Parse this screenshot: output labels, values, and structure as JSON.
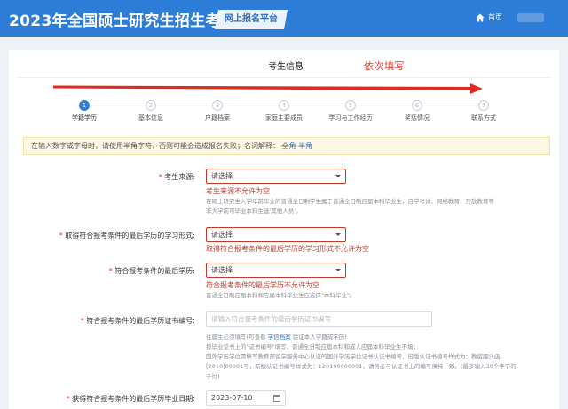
{
  "header": {
    "title": "2023年全国硕士研究生招生考试",
    "platform": "网上报名平台",
    "home_label": "首页"
  },
  "section": {
    "title": "考生信息",
    "note": "依次填写"
  },
  "steps": [
    {
      "num": "1",
      "label": "学籍学历",
      "active": true
    },
    {
      "num": "2",
      "label": "基本信息"
    },
    {
      "num": "3",
      "label": "户籍档案"
    },
    {
      "num": "4",
      "label": "家庭主要成员"
    },
    {
      "num": "5",
      "label": "学习与工作经历"
    },
    {
      "num": "6",
      "label": "奖惩情况"
    },
    {
      "num": "7",
      "label": "联系方式"
    }
  ],
  "notice": {
    "text": "在输入数字或字母时，请使用半角字符，否则可能会造成报名失败；名词解释：",
    "link1": "全角",
    "link2": "半角"
  },
  "form": {
    "source": {
      "label": "考生来源:",
      "value": "请选择",
      "error": "考生来源不允许为空",
      "help1": "在硕士研究生入学年前毕业的普通全日制学生属于普通全日制应届本科毕业生，自学考试、网络教育、开放教育等",
      "help2": "非大学前可毕业本科生选'其他人员'。"
    },
    "study_form": {
      "label": "取得符合报考条件的最后学历的学习形式:",
      "value": "请选择",
      "error": "取得符合报考条件的最后学历的学习形式不允许为空"
    },
    "last_degree": {
      "label": "符合报考条件的最后学历:",
      "value": "请选择",
      "error": "符合报考条件的最后学历不允许为空",
      "help": "普通全日制应届本科和应届本科毕业生应选择\"本科毕业\"。"
    },
    "cert_no": {
      "label": "符合报考条件的最后学历证书编号:",
      "placeholder": "请输入符合报考条件的最后学历证书编号",
      "help1": "往届生必须填写(可查看",
      "help_link": "学信档案",
      "help1b": "验证本人学籍或学历)",
      "help2": "按毕业证书上的\"证书编号\"填写，普通全日制应届本科和成人应届本科毕业生不填；",
      "help3": "国外学历学位需填写教育部留学服务中心认证的国外学历学位证书认证书编号，旧版认证书编号样式为：教留服认函",
      "help4": "[2010]00001号，新版认证书编号样式为：120190000001，请务必与认证书上的编号保持一致。(最多输入30个字节的",
      "help5": "字符)"
    },
    "grad_date": {
      "label": "获得符合报考条件的最后学历毕业日期:",
      "value": "2023-07-10"
    }
  },
  "colors": {
    "header_bg": "#2d7dd8",
    "accent_red": "#e0392b",
    "error": "#c0392b"
  }
}
